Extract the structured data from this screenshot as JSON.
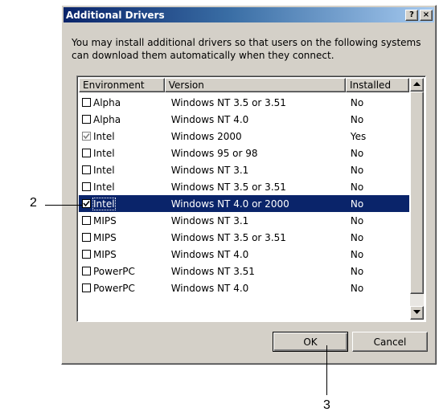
{
  "dialog": {
    "title": "Additional Drivers",
    "help_btn": "?",
    "close_btn": "×",
    "instructions": "You may install additional drivers so that users on the following systems can download them automatically when they connect."
  },
  "table": {
    "columns": [
      "Environment",
      "Version",
      "Installed"
    ],
    "rows": [
      {
        "environment": "Alpha",
        "version": "Windows NT 3.5 or 3.51",
        "installed": "No",
        "checked": false,
        "disabled": false,
        "selected": false
      },
      {
        "environment": "Alpha",
        "version": "Windows NT 4.0",
        "installed": "No",
        "checked": false,
        "disabled": false,
        "selected": false
      },
      {
        "environment": "Intel",
        "version": "Windows 2000",
        "installed": "Yes",
        "checked": true,
        "disabled": true,
        "selected": false
      },
      {
        "environment": "Intel",
        "version": "Windows 95 or 98",
        "installed": "No",
        "checked": false,
        "disabled": false,
        "selected": false
      },
      {
        "environment": "Intel",
        "version": "Windows NT 3.1",
        "installed": "No",
        "checked": false,
        "disabled": false,
        "selected": false
      },
      {
        "environment": "Intel",
        "version": "Windows NT 3.5 or 3.51",
        "installed": "No",
        "checked": false,
        "disabled": false,
        "selected": false
      },
      {
        "environment": "Intel",
        "version": "Windows NT 4.0 or 2000",
        "installed": "No",
        "checked": true,
        "disabled": false,
        "selected": true
      },
      {
        "environment": "MIPS",
        "version": "Windows NT 3.1",
        "installed": "No",
        "checked": false,
        "disabled": false,
        "selected": false
      },
      {
        "environment": "MIPS",
        "version": "Windows NT 3.5 or 3.51",
        "installed": "No",
        "checked": false,
        "disabled": false,
        "selected": false
      },
      {
        "environment": "MIPS",
        "version": "Windows NT 4.0",
        "installed": "No",
        "checked": false,
        "disabled": false,
        "selected": false
      },
      {
        "environment": "PowerPC",
        "version": "Windows NT 3.51",
        "installed": "No",
        "checked": false,
        "disabled": false,
        "selected": false
      },
      {
        "environment": "PowerPC",
        "version": "Windows NT 4.0",
        "installed": "No",
        "checked": false,
        "disabled": false,
        "selected": false
      }
    ]
  },
  "buttons": {
    "ok": "OK",
    "cancel": "Cancel"
  },
  "callouts": {
    "two": "2",
    "three": "3"
  },
  "colors": {
    "selection": "#0a246a",
    "face": "#d4d0c8"
  }
}
